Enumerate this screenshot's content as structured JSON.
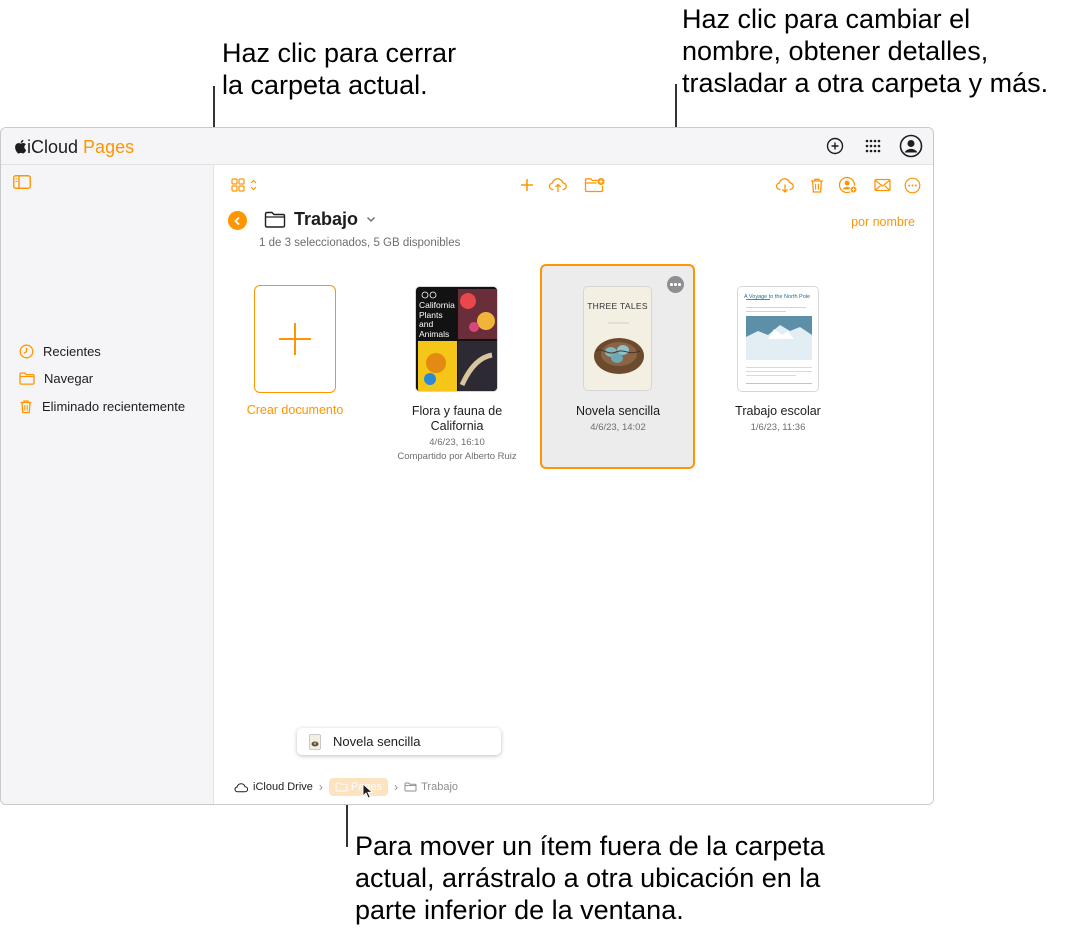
{
  "callouts": {
    "close_folder": [
      "Haz clic para cerrar",
      "la carpeta actual."
    ],
    "more_options": [
      "Haz clic para cambiar el",
      "nombre, obtener detalles,",
      "trasladar a otra carpeta y más."
    ],
    "move_item": [
      "Para mover un ítem fuera de la carpeta",
      "actual, arrástralo a otra ubicación en la",
      "parte inferior de la ventana."
    ]
  },
  "app": {
    "brand_icloud": "iCloud",
    "brand_pages": "Pages"
  },
  "sidebar": {
    "items": [
      {
        "label": "Recientes",
        "icon": "clock-icon"
      },
      {
        "label": "Navegar",
        "icon": "folder-icon"
      },
      {
        "label": "Eliminado recientemente",
        "icon": "trash-icon"
      }
    ]
  },
  "folder": {
    "title": "Trabajo",
    "subtitle": "1 de 3 seleccionados, 5 GB disponibles",
    "sort_label": "por nombre"
  },
  "documents": {
    "create_label": "Crear documento",
    "items": [
      {
        "name_line1": "Flora y fauna de",
        "name_line2": "California",
        "date": "4/6/23, 16:10",
        "shared": "Compartido por Alberto Ruiz",
        "thumb_title": "California Plants and Animals"
      },
      {
        "name_line1": "Novela sencilla",
        "date": "4/6/23, 14:02",
        "thumb_title": "THREE TALES",
        "selected": true
      },
      {
        "name_line1": "Trabajo escolar",
        "date": "1/6/23, 11:36",
        "thumb_title": "A Voyage to the North Pole"
      }
    ]
  },
  "drag": {
    "label": "Novela sencilla"
  },
  "breadcrumb": {
    "root": "iCloud Drive",
    "middle": "Pages",
    "current": "Trabajo"
  },
  "colors": {
    "accent": "#ff9500",
    "sidebar_bg": "#f5f5f7",
    "selected_bg": "#ececec",
    "drop_highlight": "#fde3bf"
  }
}
